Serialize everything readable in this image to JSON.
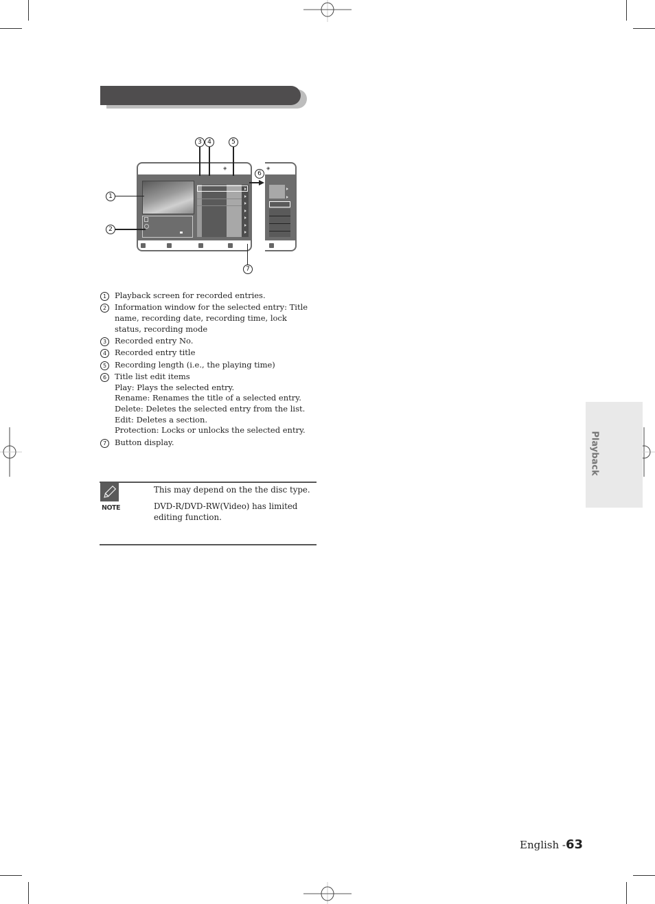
{
  "header": {
    "title": ""
  },
  "diagram": {
    "callouts": [
      "1",
      "2",
      "3",
      "4",
      "5",
      "6",
      "7"
    ],
    "screen_icons": [
      "disc-icon",
      "clock-icon",
      "lock-icon"
    ],
    "button_icons": [
      "info-button-icon",
      "menu-button-icon",
      "return-button-icon",
      "exit-button-icon"
    ]
  },
  "descriptions": [
    {
      "num": "1",
      "lines": [
        "Playback screen for recorded entries."
      ]
    },
    {
      "num": "2",
      "lines": [
        "Information window for the selected entry: Title name, recording date, recording time, lock status, recording mode"
      ]
    },
    {
      "num": "3",
      "lines": [
        "Recorded entry No."
      ]
    },
    {
      "num": "4",
      "lines": [
        "Recorded entry title"
      ]
    },
    {
      "num": "5",
      "lines": [
        "Recording length (i.e., the playing time)"
      ]
    },
    {
      "num": "6",
      "lines": [
        "Title list edit items",
        "Play: Plays the selected entry.",
        "Rename: Renames the title of a selected entry.",
        "Delete: Deletes the selected entry from the list.",
        "Edit: Deletes a section.",
        "Protection: Locks or unlocks the selected entry."
      ]
    },
    {
      "num": "7",
      "lines": [
        "Button display."
      ]
    }
  ],
  "note": {
    "label": "NOTE",
    "items": [
      "This may depend on the the disc type.",
      "DVD-R/DVD-RW(Video) has limited editing function."
    ]
  },
  "side_tab": {
    "label": "Playback"
  },
  "footer": {
    "language": "English -",
    "page_number": "63"
  }
}
